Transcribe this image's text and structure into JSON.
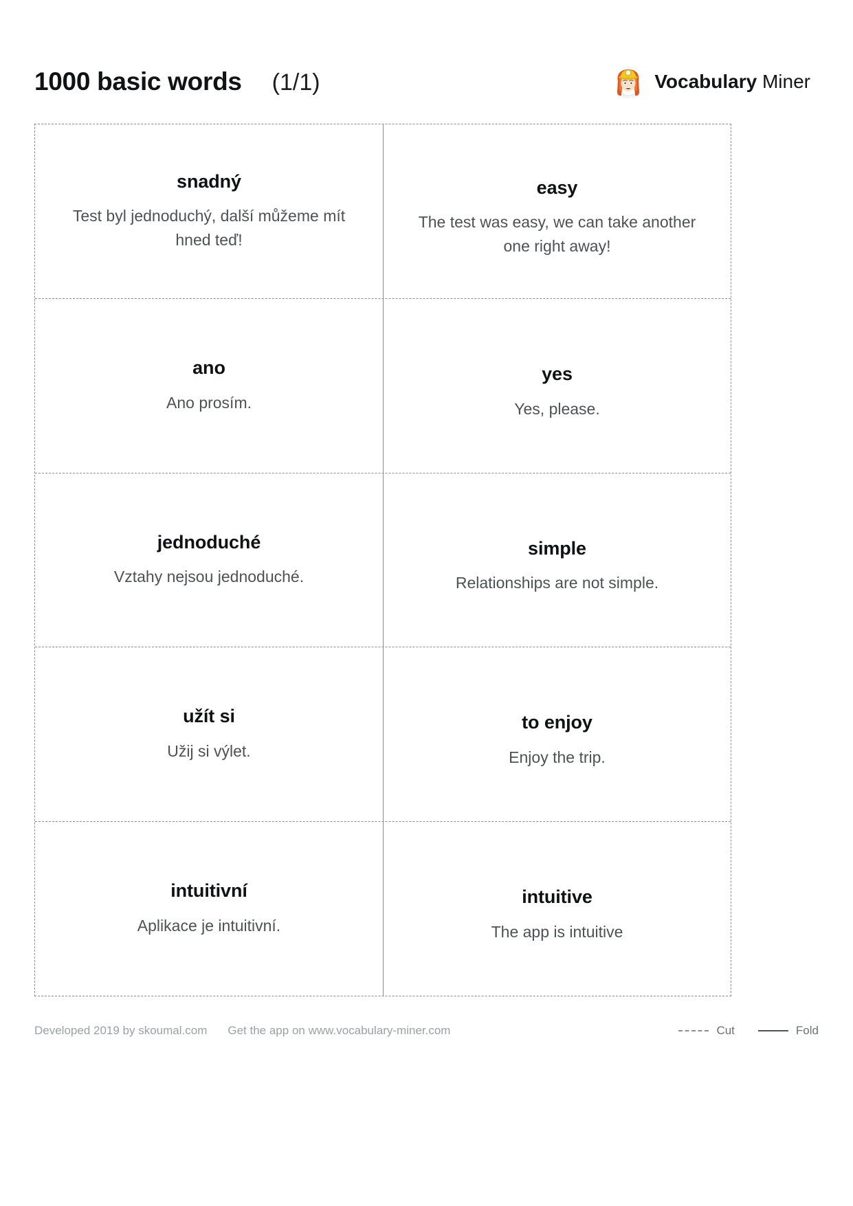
{
  "header": {
    "deck_title": "1000 basic words",
    "page_count": "(1/1)",
    "brand_primary": "Vocabulary",
    "brand_secondary": "Miner",
    "logo_icon": "miner-avatar-icon"
  },
  "cards": [
    {
      "front_term": "snadný",
      "front_example": "Test byl jednoduchý, další můžeme mít hned teď!",
      "back_term": "easy",
      "back_example": "The test was easy, we can take another one right away!"
    },
    {
      "front_term": "ano",
      "front_example": "Ano prosím.",
      "back_term": "yes",
      "back_example": "Yes, please."
    },
    {
      "front_term": "jednoduché",
      "front_example": "Vztahy nejsou jednoduché.",
      "back_term": "simple",
      "back_example": "Relationships are not simple."
    },
    {
      "front_term": "užít si",
      "front_example": "Užij si výlet.",
      "back_term": "to enjoy",
      "back_example": "Enjoy the trip."
    },
    {
      "front_term": "intuitivní",
      "front_example": "Aplikace je intuitivní.",
      "back_term": "intuitive",
      "back_example": "The app is intuitive"
    }
  ],
  "footer": {
    "developed_by": "Developed 2019 by skoumal.com",
    "get_the_app": "Get the app on www.vocabulary-miner.com",
    "cut_label": "Cut",
    "fold_label": "Fold"
  },
  "colors": {
    "cut_line": "#8a8d91",
    "fold_line": "#8a8d91",
    "term_text": "#101112",
    "example_text": "#4d5156",
    "footer_text": "#9aa0a6",
    "page_background": "#ffffff"
  }
}
